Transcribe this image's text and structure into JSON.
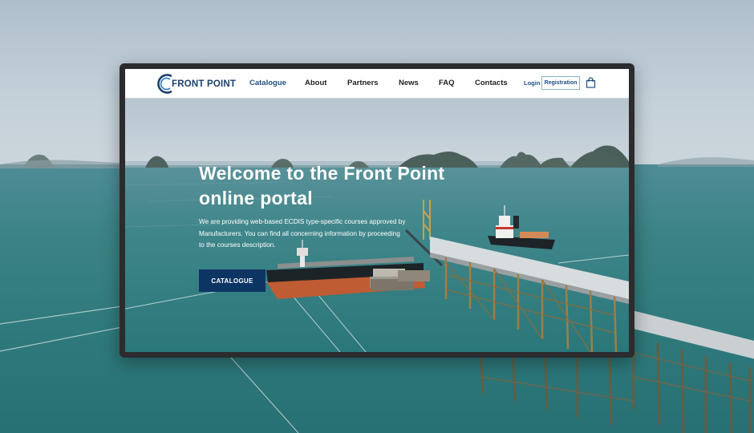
{
  "brand": {
    "name": "FRONT POINT"
  },
  "nav": {
    "items": [
      {
        "label": "Catalogue",
        "active": true
      },
      {
        "label": "About",
        "active": false
      },
      {
        "label": "Partners",
        "active": false
      },
      {
        "label": "News",
        "active": false
      },
      {
        "label": "FAQ",
        "active": false
      },
      {
        "label": "Contacts",
        "active": false
      }
    ],
    "login_label": "Login",
    "register_label": "Registration",
    "cart_icon": "shopping-bag-icon"
  },
  "hero": {
    "title_lines": [
      "Welcome to the Front Point",
      "online portal"
    ],
    "description_lines": [
      "We are providing web-based ECDIS type-specific courses approved by",
      "Manufacturers. You can find all concerning information by proceeding",
      "to the courses description."
    ],
    "cta_label": "CATALOGUE"
  },
  "colors": {
    "brand_navy": "#0d3564",
    "link_blue": "#1f4f82",
    "sea": "#2f7f82",
    "sky": "#c2ced6"
  }
}
